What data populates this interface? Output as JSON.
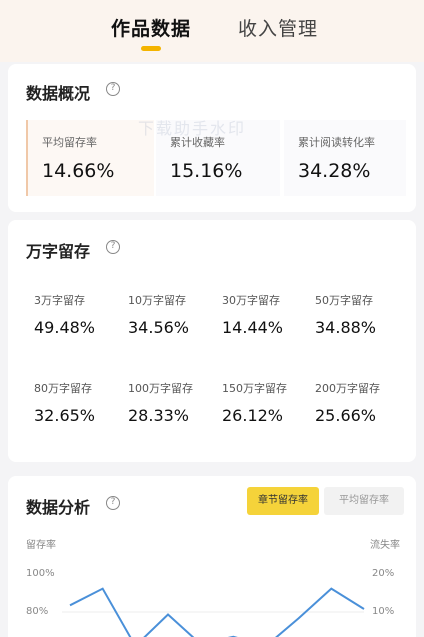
{
  "tabs": [
    {
      "label": "作品数据",
      "active": true
    },
    {
      "label": "收入管理",
      "active": false
    }
  ],
  "watermark": "下载助手水印",
  "overview": {
    "title": "数据概况",
    "items": [
      {
        "label": "平均留存率",
        "value": "14.66%"
      },
      {
        "label": "累计收藏率",
        "value": "15.16%"
      },
      {
        "label": "累计阅读转化率",
        "value": "34.28%"
      }
    ]
  },
  "retention": {
    "title": "万字留存",
    "items": [
      {
        "label": "3万字留存",
        "value": "49.48%"
      },
      {
        "label": "10万字留存",
        "value": "34.56%"
      },
      {
        "label": "30万字留存",
        "value": "14.44%"
      },
      {
        "label": "50万字留存",
        "value": "34.88%"
      },
      {
        "label": "80万字留存",
        "value": "32.65%"
      },
      {
        "label": "100万字留存",
        "value": "28.33%"
      },
      {
        "label": "150万字留存",
        "value": "26.12%"
      },
      {
        "label": "200万字留存",
        "value": "25.66%"
      }
    ]
  },
  "analysis": {
    "title": "数据分析",
    "toggle_active": "章节留存率",
    "toggle_inactive": "平均留存率",
    "left_axis_label": "留存率",
    "right_axis_label": "流失率",
    "left_ticks": [
      "100%",
      "80%"
    ],
    "right_ticks": [
      "20%",
      "10%"
    ],
    "line_color": "#4a90d9"
  },
  "chart_data": {
    "type": "line",
    "title": "",
    "ylabel": "留存率",
    "y2label": "流失率",
    "ylim": [
      60,
      100
    ],
    "x": [
      1,
      2,
      3,
      4,
      5,
      6,
      7,
      8,
      9,
      10
    ],
    "series": [
      {
        "values": [
          82,
          91,
          60,
          77,
          61,
          65,
          60,
          75,
          91,
          80
        ]
      }
    ]
  }
}
